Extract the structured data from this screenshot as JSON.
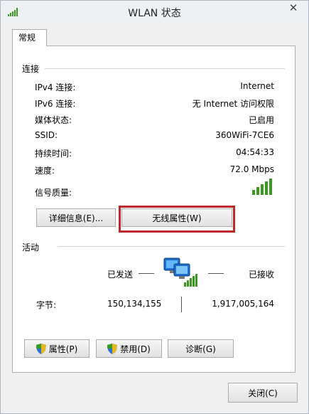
{
  "window": {
    "title": "WLAN 状态",
    "close_glyph": "✕"
  },
  "tab": {
    "label": "常规"
  },
  "connection": {
    "section_label": "连接",
    "rows": [
      {
        "label": "IPv4 连接:",
        "value": "Internet"
      },
      {
        "label": "IPv6 连接:",
        "value": "无 Internet 访问权限"
      },
      {
        "label": "媒体状态:",
        "value": "已启用"
      },
      {
        "label": "SSID:",
        "value": "360WiFi-7CE6"
      },
      {
        "label": "持续时间:",
        "value": "04:54:33"
      },
      {
        "label": "速度:",
        "value": "72.0 Mbps"
      }
    ],
    "signal_label": "信号质量:",
    "signal_level": 5,
    "signal_max": 5,
    "details_button": "详细信息(E)...",
    "wireless_props_button": "无线属性(W)"
  },
  "activity": {
    "section_label": "活动",
    "sent_label": "已发送",
    "received_label": "已接收",
    "bytes_label": "字节:",
    "bytes_sent": "150,134,155",
    "bytes_received": "1,917,005,164"
  },
  "actions": {
    "properties_button": "属性(P)",
    "disable_button": "禁用(D)",
    "diagnose_button": "诊断(G)"
  },
  "footer": {
    "close_button": "关闭(C)"
  },
  "colors": {
    "highlight": "#c0282c",
    "signal_green": "#3a9a1f"
  }
}
